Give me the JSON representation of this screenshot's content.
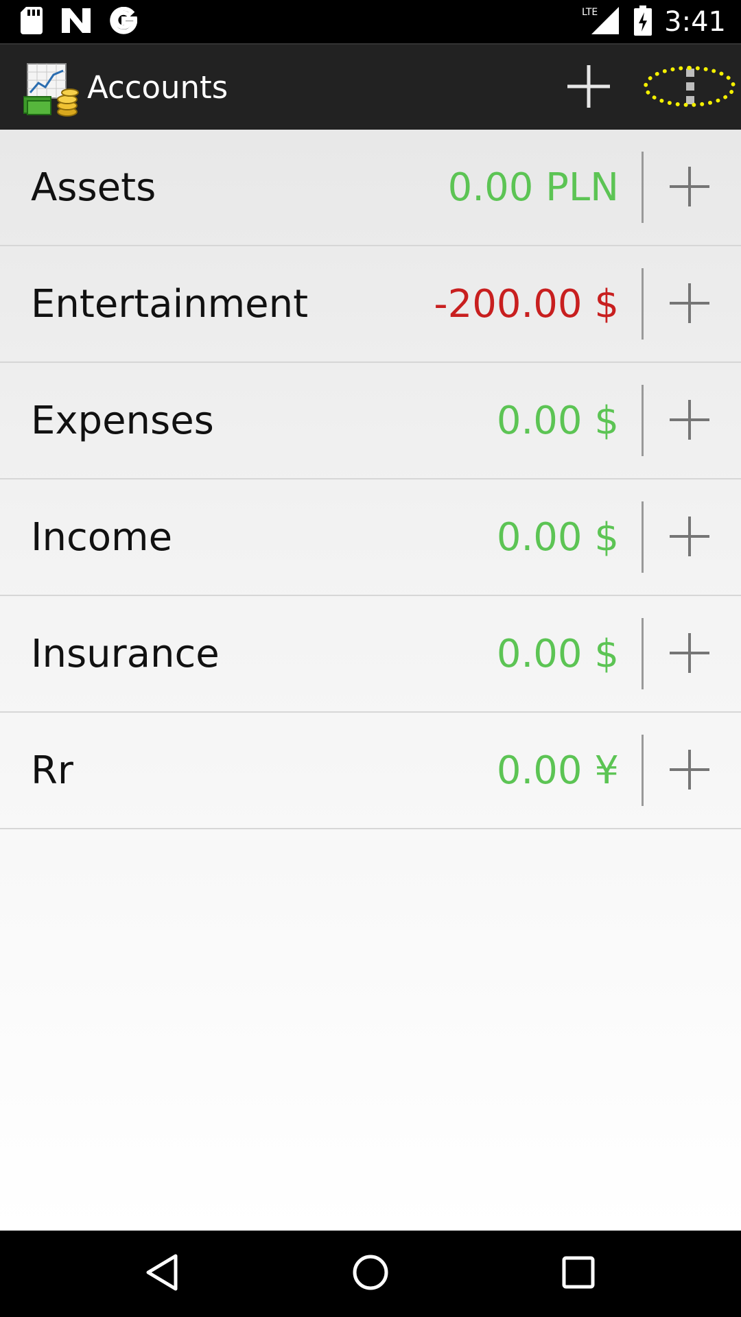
{
  "status_bar": {
    "icons": [
      "sd-card-icon",
      "n-logo-icon",
      "google-icon",
      "lte-signal-icon",
      "battery-charging-icon"
    ],
    "network_label": "LTE",
    "time": "3:41"
  },
  "action_bar": {
    "title": "Accounts",
    "app_icon": "accounts-app-icon",
    "add_icon": "plus-icon",
    "overflow_icon": "more-vertical-icon",
    "highlight_color": "#f4f000"
  },
  "accounts": [
    {
      "name": "Assets",
      "amount": "0.00 PLN",
      "status": "positive"
    },
    {
      "name": "Entertainment",
      "amount": "-200.00 $",
      "status": "negative"
    },
    {
      "name": "Expenses",
      "amount": "0.00 $",
      "status": "positive"
    },
    {
      "name": "Income",
      "amount": "0.00 $",
      "status": "positive"
    },
    {
      "name": "Insurance",
      "amount": "0.00 $",
      "status": "positive"
    },
    {
      "name": "Rr",
      "amount": "0.00 ¥",
      "status": "positive"
    }
  ],
  "colors": {
    "positive": "#5cc454",
    "negative": "#c81f1f",
    "action_bar": "#222222"
  },
  "nav_bar": {
    "icons": [
      "back-icon",
      "home-icon",
      "recents-icon"
    ]
  }
}
